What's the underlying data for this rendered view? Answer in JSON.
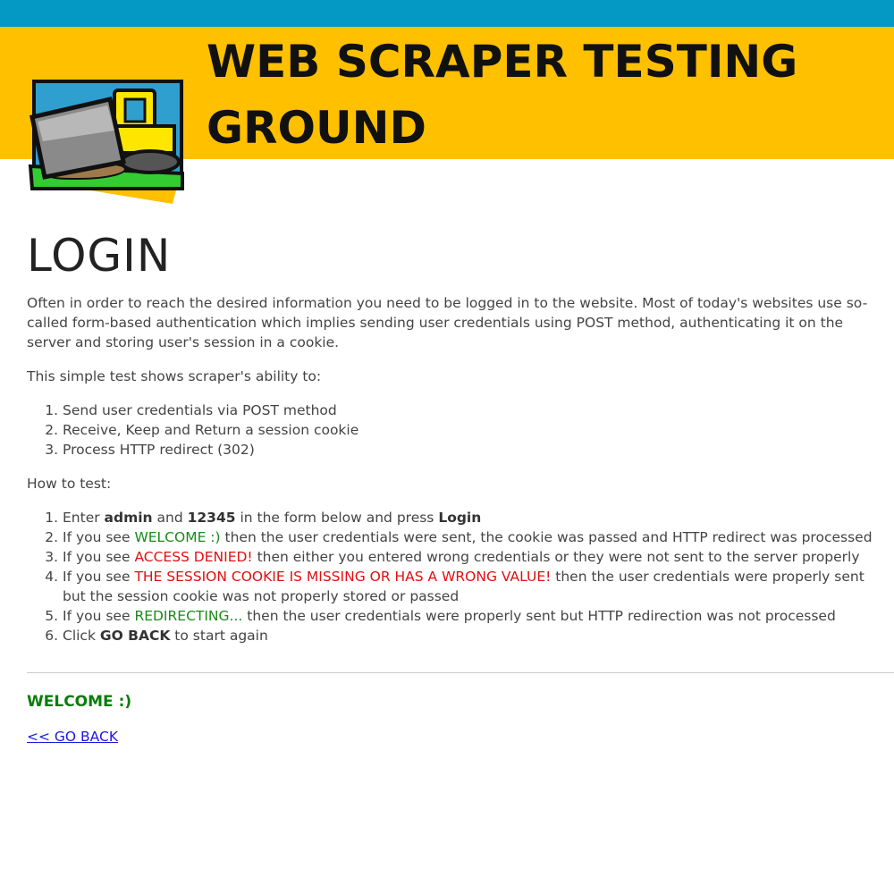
{
  "header": {
    "title": "WEB SCRAPER TESTING GROUND",
    "logo_icon": "bulldozer-logo-icon",
    "top_bar_color": "#0399c4",
    "banner_color": "#ffc000"
  },
  "main": {
    "heading": "LOGIN",
    "intro": "Often in order to reach the desired information you need to be logged in to the website. Most of today's websites use so-called form-based authentication which implies sending user credentials using POST method, authenticating it on the server and storing user's session in a cookie.",
    "ability_intro": "This simple test shows scraper's ability to:",
    "abilities": [
      "Send user credentials via POST method",
      "Receive, Keep and Return a session cookie",
      "Process HTTP redirect (302)"
    ],
    "howto_label": "How to test:",
    "steps": {
      "s1": {
        "a": "Enter ",
        "user": "admin",
        "b": " and ",
        "pass": "12345",
        "c": " in the form below and press ",
        "btn": "Login"
      },
      "s2": {
        "a": "If you see ",
        "hl": "WELCOME :)",
        "b": " then the user credentials were sent, the cookie was passed and HTTP redirect was processed"
      },
      "s3": {
        "a": "If you see ",
        "hl": "ACCESS DENIED!",
        "b": " then either you entered wrong credentials or they were not sent to the server properly"
      },
      "s4": {
        "a": "If you see ",
        "hl": "THE SESSION COOKIE IS MISSING OR HAS A WRONG VALUE!",
        "b": " then the user credentials were properly sent but the session cookie was not properly stored or passed"
      },
      "s5": {
        "a": "If you see ",
        "hl": "REDIRECTING...",
        "b": " then the user credentials were properly sent but HTTP redirection was not processed"
      },
      "s6": {
        "a": "Click ",
        "bold": "GO BACK",
        "b": " to start again"
      }
    },
    "result": "WELCOME :)",
    "back_link": "<< GO BACK",
    "colors": {
      "success": "#0a7d0a",
      "error": "#e01010",
      "link": "#1a1ae0"
    }
  }
}
